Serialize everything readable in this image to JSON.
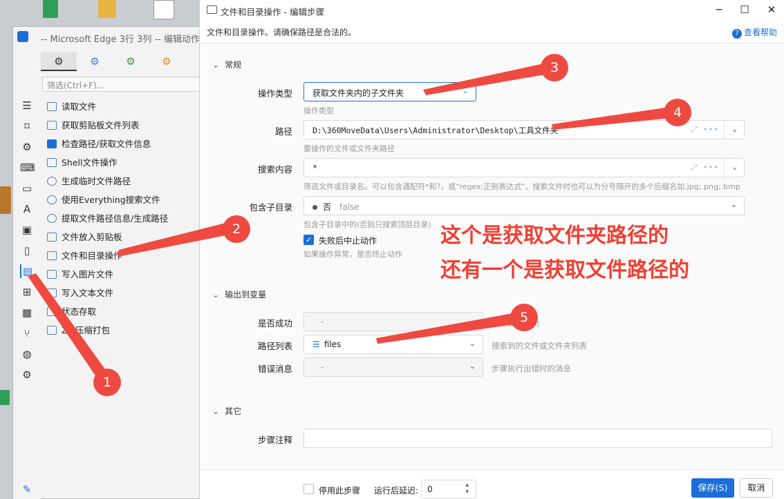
{
  "background_window": {
    "title": "-- Microsoft Edge 3行 3列 -- 编辑动作",
    "tabs": [
      "⚙",
      "⚙",
      "⚙",
      "⚙"
    ],
    "filter_placeholder": "筛选(Ctrl+F)...",
    "sidebar_icons": [
      "menu-icon",
      "bookmark-icon",
      "settings-icon",
      "keyboard-icon",
      "window-icon",
      "text-icon",
      "image-icon",
      "clipboard-icon",
      "file-icon",
      "windows-icon",
      "grid-icon",
      "branch-icon",
      "globe-icon",
      "gears-icon",
      "wrench-icon"
    ],
    "actions": [
      "读取文件",
      "获取剪贴板文件列表",
      "检查路径/获取文件信息",
      "Shell文件操作",
      "生成临时文件路径",
      "使用Everything搜索文件",
      "提取文件路径信息/生成路径",
      "文件放入剪贴板",
      "文件和目录操作",
      "写入图片文件",
      "写入文本文件",
      "状态存取",
      "Zip压缩打包"
    ]
  },
  "dialog": {
    "title": "文件和目录操作 - 编辑步骤",
    "description": "文件和目录操作。请确保路径是合法的。",
    "help_link": "查看帮助",
    "section_general": "常规",
    "op_type_label": "操作类型",
    "op_type_value": "获取文件夹内的子文件夹",
    "op_type_help": "操作类型",
    "path_label": "路径",
    "path_value": "D:\\360MoveData\\Users\\Administrator\\Desktop\\工具文件夹",
    "path_help": "要操作的文件或文件夹路径",
    "search_label": "搜索内容",
    "search_value": "*",
    "search_help": "筛选文件或目录名。可以包含通配符*和?，或\"regex:正则表达式\"。搜索文件时也可以为分号隔开的多个后缀名如.jpg;.png;.bmp",
    "subdir_label": "包含子目录",
    "subdir_value": "否",
    "subdir_raw": "false",
    "subdir_help": "包含子目录中的(否则只搜索顶层目录)",
    "stop_on_fail_label": "失败后中止动作",
    "stop_on_fail_checked": true,
    "stop_on_fail_help": "如果操作异常，是否终止动作",
    "section_output": "输出到变量",
    "success_label": "是否成功",
    "success_value": "-",
    "success_help": "操作是否成功",
    "pathlist_label": "路径列表",
    "pathlist_value": "files",
    "pathlist_help": "搜索到的文件或文件夹列表",
    "error_label": "错误消息",
    "error_value": "-",
    "error_help": "步骤执行出错时的消息",
    "section_other": "其它",
    "note_label": "步骤注释",
    "note_value": "",
    "disable_step_label": "停用此步骤",
    "delay_label": "运行后延迟:",
    "delay_value": "0",
    "save_label": "保存(S)",
    "cancel_label": "取消"
  },
  "annotations": {
    "numbers": [
      "1",
      "2",
      "3",
      "4",
      "5"
    ],
    "note_line1": "这个是获取文件夹路径的",
    "note_line2": "还有一个是获取文件路径的",
    "color": "#ef4a41"
  }
}
